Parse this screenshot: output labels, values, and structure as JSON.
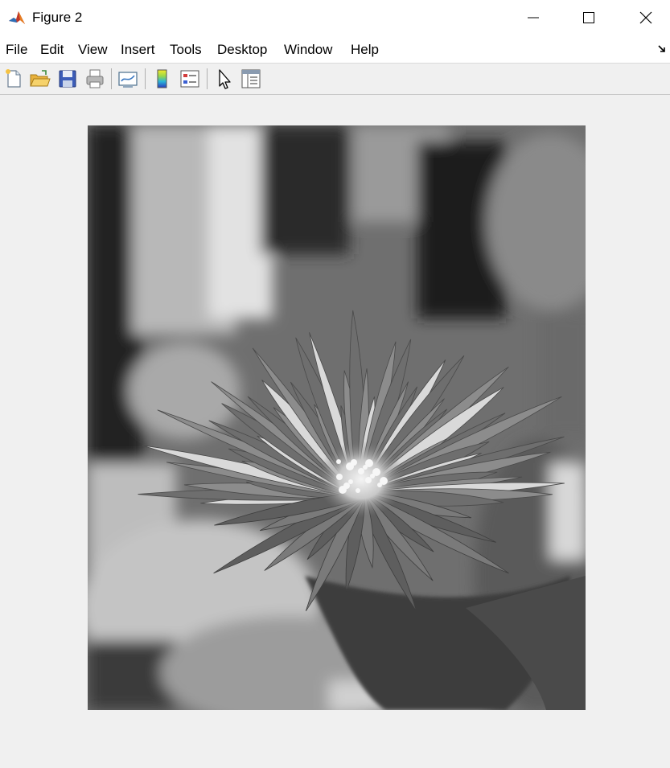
{
  "window": {
    "title": "Figure 2",
    "icon": "matlab-logo-icon",
    "controls": [
      "minimize-icon",
      "maximize-icon",
      "close-icon"
    ]
  },
  "menubar": {
    "items": [
      "File",
      "Edit",
      "View",
      "Insert",
      "Tools",
      "Desktop",
      "Window",
      "Help"
    ],
    "dock_icon": "dock-arrow-icon"
  },
  "toolbar": {
    "tools": [
      "new-figure-icon",
      "open-file-icon",
      "save-figure-icon",
      "print-figure-icon",
      "link-plot-icon",
      "insert-colorbar-icon",
      "insert-legend-icon",
      "edit-plot-icon",
      "property-inspector-icon"
    ]
  },
  "figure": {
    "content": "grayscale-image",
    "colormap": "gray"
  }
}
